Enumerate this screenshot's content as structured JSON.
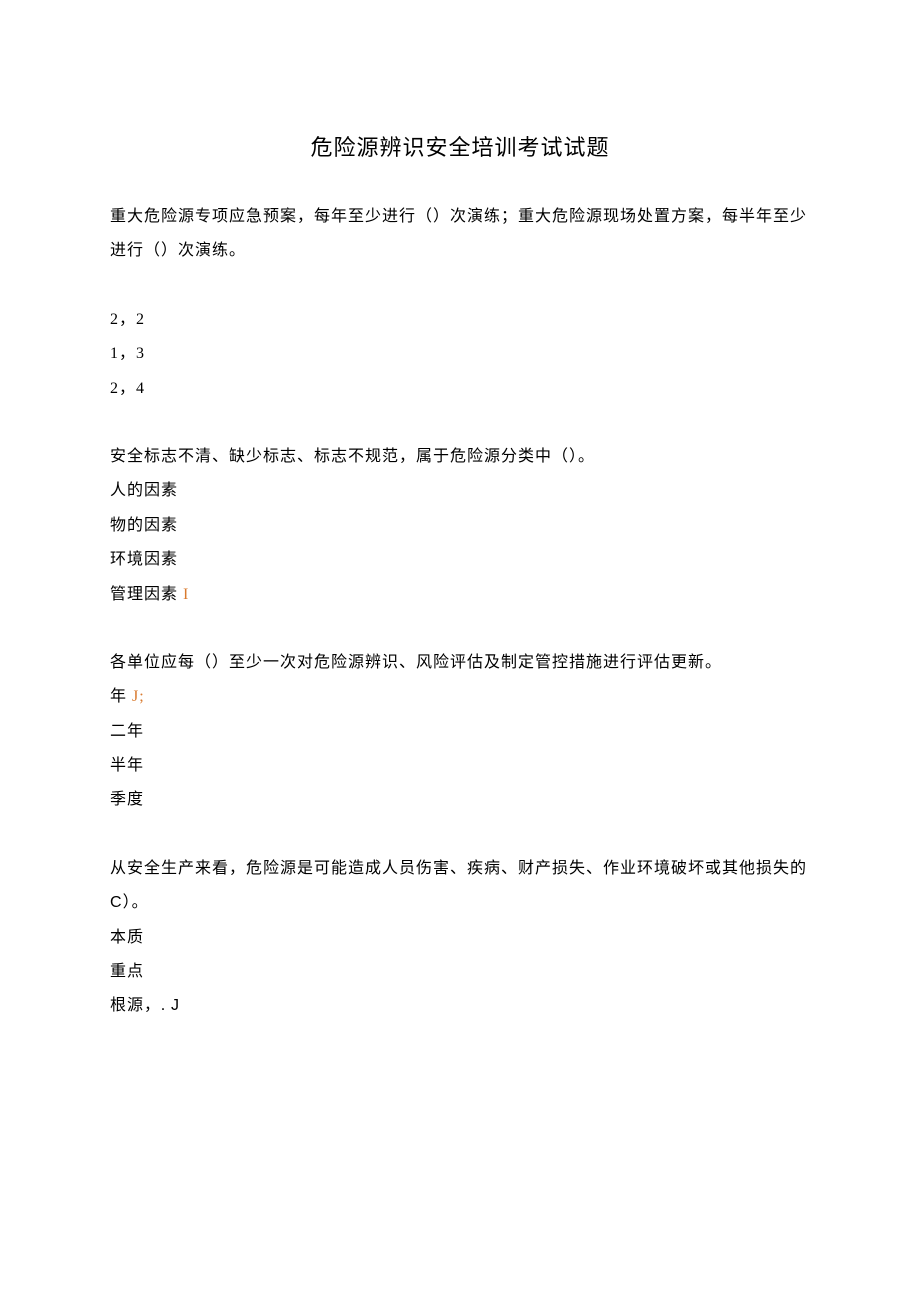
{
  "title": "危险源辨识安全培训考试试题",
  "q1": {
    "stem": "重大危险源专项应急预案，每年至少进行（）次演练；重大危险源现场处置方案，每半年至少进行（）次演练。",
    "opts": [
      "2，2",
      "1，3",
      "2，4"
    ]
  },
  "q2": {
    "stem": "安全标志不清、缺少标志、标志不规范，属于危险源分类中（）。",
    "opts": [
      "人的因素",
      "物的因素",
      "环境因素",
      "管理因素"
    ],
    "mark": "I"
  },
  "q3": {
    "stem": "各单位应每（）至少一次对危险源辨识、风险评估及制定管控措施进行评估更新。",
    "opts": [
      "年",
      "二年",
      "半年",
      "季度"
    ],
    "mark": "J;"
  },
  "q4": {
    "stemPart1": "从安全生产来看，危险源是可能造成人员伤害、疾病、财产损失、作业环境破坏或其他损失的",
    "stemC": "C",
    "stemPart2": "）。",
    "opts": [
      "本质",
      "重点",
      "根源，."
    ],
    "mark": "J"
  }
}
